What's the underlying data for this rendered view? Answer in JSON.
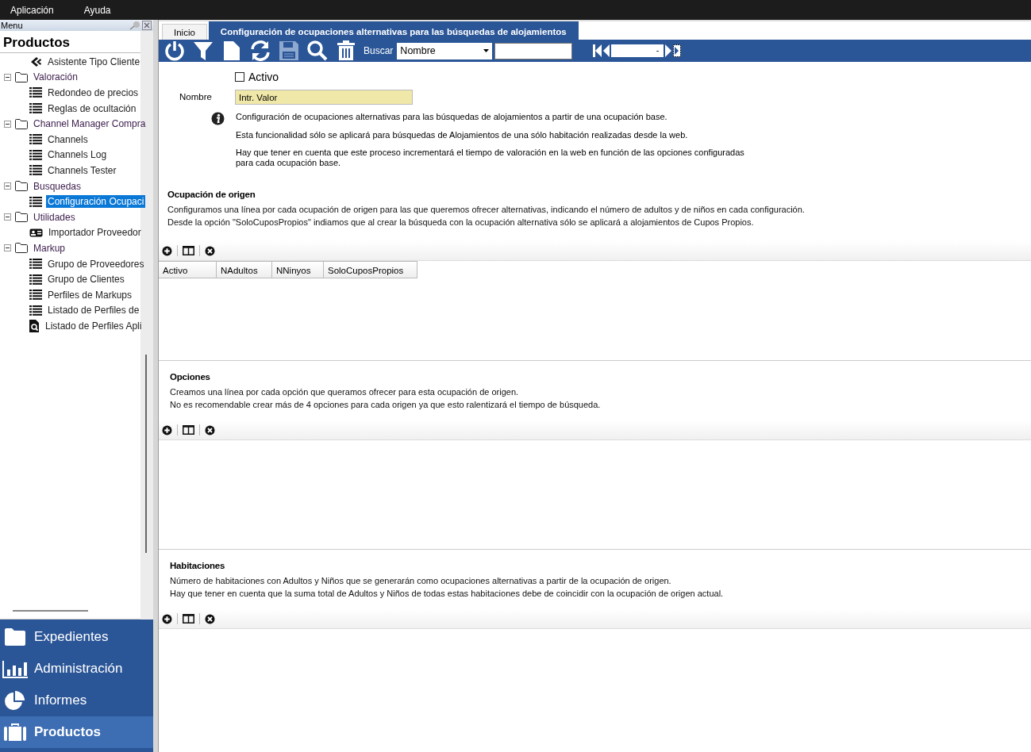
{
  "menubar": [
    "Aplicación",
    "Ayuda"
  ],
  "sidebar": {
    "header": "Menu",
    "title": "Productos",
    "tree": [
      {
        "label": "Asistente Tipo Cliente",
        "kind": "wizard",
        "selected": false
      },
      {
        "label": "Valoración",
        "expanded": true,
        "children": [
          {
            "label": "Redondeo de precios",
            "kind": "list",
            "selected": false
          },
          {
            "label": "Reglas de ocultación",
            "kind": "list",
            "selected": false
          }
        ]
      },
      {
        "label": "Channel Manager Compra",
        "expanded": true,
        "children": [
          {
            "label": "Channels",
            "kind": "list",
            "selected": false
          },
          {
            "label": "Channels Log",
            "kind": "list",
            "selected": false
          },
          {
            "label": "Channels Tester",
            "kind": "list",
            "selected": false
          }
        ]
      },
      {
        "label": "Busquedas",
        "expanded": true,
        "children": [
          {
            "label": "Configuración Ocupaci",
            "kind": "list",
            "selected": true
          }
        ]
      },
      {
        "label": "Utilidades",
        "expanded": true,
        "children": [
          {
            "label": "Importador Proveedor",
            "kind": "import",
            "selected": false
          }
        ]
      },
      {
        "label": "Markup",
        "expanded": true,
        "children": [
          {
            "label": "Grupo de Proveedores",
            "kind": "list",
            "selected": false
          },
          {
            "label": "Grupo de Clientes",
            "kind": "list",
            "selected": false
          },
          {
            "label": "Perfiles de Markups",
            "kind": "list",
            "selected": false
          },
          {
            "label": "Listado de Perfiles de",
            "kind": "list",
            "selected": false
          },
          {
            "label": "Listado de Perfiles Apli",
            "kind": "doc-search",
            "selected": false
          }
        ]
      }
    ],
    "nav": [
      {
        "label": "Expedientes",
        "kind": "folder",
        "selected": false
      },
      {
        "label": "Administración",
        "kind": "chart",
        "selected": false
      },
      {
        "label": "Informes",
        "kind": "pie",
        "selected": false
      },
      {
        "label": "Productos",
        "kind": "briefcase",
        "selected": true
      }
    ]
  },
  "tabs": [
    {
      "label": "Inicio",
      "selected": false
    },
    {
      "label": "Configuración de ocupaciones alternativas para las búsquedas de alojamientos",
      "selected": true
    }
  ],
  "toolbar": {
    "search_label": "Buscar",
    "search_field": "Nombre",
    "record_field": "-"
  },
  "form": {
    "active": {
      "label": "Activo",
      "checked": false
    },
    "name": {
      "label": "Nombre",
      "value": "Intr. Valor"
    },
    "info": [
      "Configuración de ocupaciones alternativas para las búsquedas de alojamientos a partir de una ocupación base.",
      "Esta funcionalidad sólo se aplicará para búsquedas de Alojamientos de una sólo habitación realizadas desde la web.",
      "Hay que tener en cuenta que este proceso incrementará el tiempo de valoración en la web en función de las opciones configuradas\npara cada ocupación base."
    ]
  },
  "sections": [
    {
      "title": "Ocupación de origen",
      "description": [
        "Configuramos una línea por cada ocupación de origen para las que queremos ofrecer alternativas, indicando el número de adultos y de niños en cada configuración.",
        "Desde la opción \"SoloCuposPropios\" indiamos que al crear la búsqueda con la ocupación alternativa sólo se aplicará a alojamientos de Cupos Propios."
      ],
      "columns": [
        "Activo",
        "NAdultos",
        "NNinyos",
        "SoloCuposPropios"
      ]
    },
    {
      "title": "Opciones",
      "description": [
        "Creamos una línea por cada opción que queramos ofrecer para esta ocupación de origen.",
        "No es recomendable crear más de 4 opciones para cada origen ya que esto ralentizará el tiempo de búsqueda."
      ]
    },
    {
      "title": "Habitaciones",
      "description": [
        "Número de habitaciones con Adultos y Niños que se generarán como ocupaciones alternativas a partir de la ocupación de origen.",
        "Hay que tener en cuenta que la suma total de Adultos y Niños de todas estas habitaciones debe de coincidir con la ocupación de origen actual."
      ]
    }
  ]
}
